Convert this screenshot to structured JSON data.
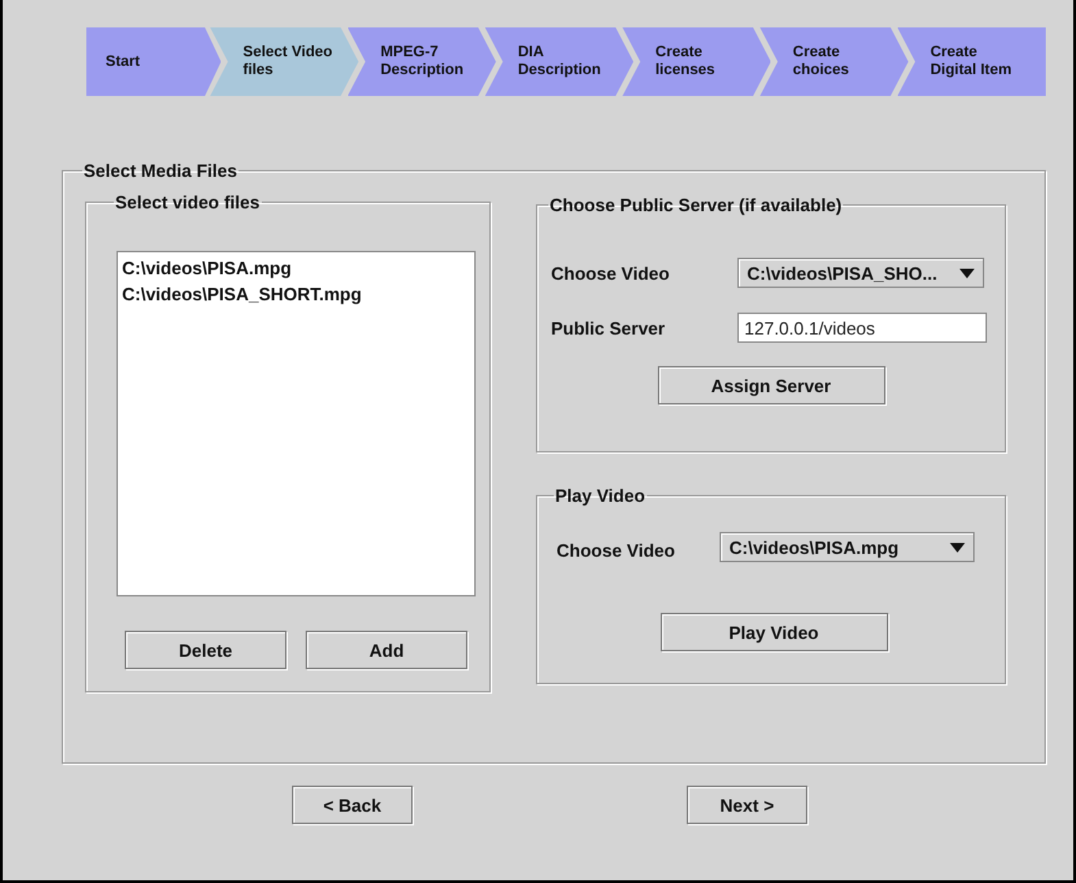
{
  "steps": [
    {
      "label": "Start",
      "selected": false
    },
    {
      "label": "Select Video files",
      "selected": true
    },
    {
      "label": "MPEG-7 Description",
      "selected": false
    },
    {
      "label": "DIA Description",
      "selected": false
    },
    {
      "label": "Create licenses",
      "selected": false
    },
    {
      "label": "Create choices",
      "selected": false
    },
    {
      "label": "Create Digital Item",
      "selected": false
    }
  ],
  "media_files": {
    "title": "Select Media Files",
    "video_files": {
      "title": "Select video files",
      "items": [
        "C:\\videos\\PISA.mpg",
        "C:\\videos\\PISA_SHORT.mpg"
      ],
      "buttons": [
        "Delete",
        "Add"
      ]
    },
    "public_server": {
      "title": "Choose Public Server (if available)",
      "choose_label": "Choose Video",
      "choose_value": "C:\\videos\\PISA_SHO...",
      "server_label": "Public Server",
      "server_value": "127.0.0.1/videos",
      "button": "Assign Server"
    },
    "play_video": {
      "title": "Play Video",
      "choose_label": "Choose Video",
      "choose_value": "C:\\videos\\PISA.mpg",
      "button": "Play Video"
    }
  },
  "nav_buttons": [
    "< Back",
    "Next >"
  ]
}
